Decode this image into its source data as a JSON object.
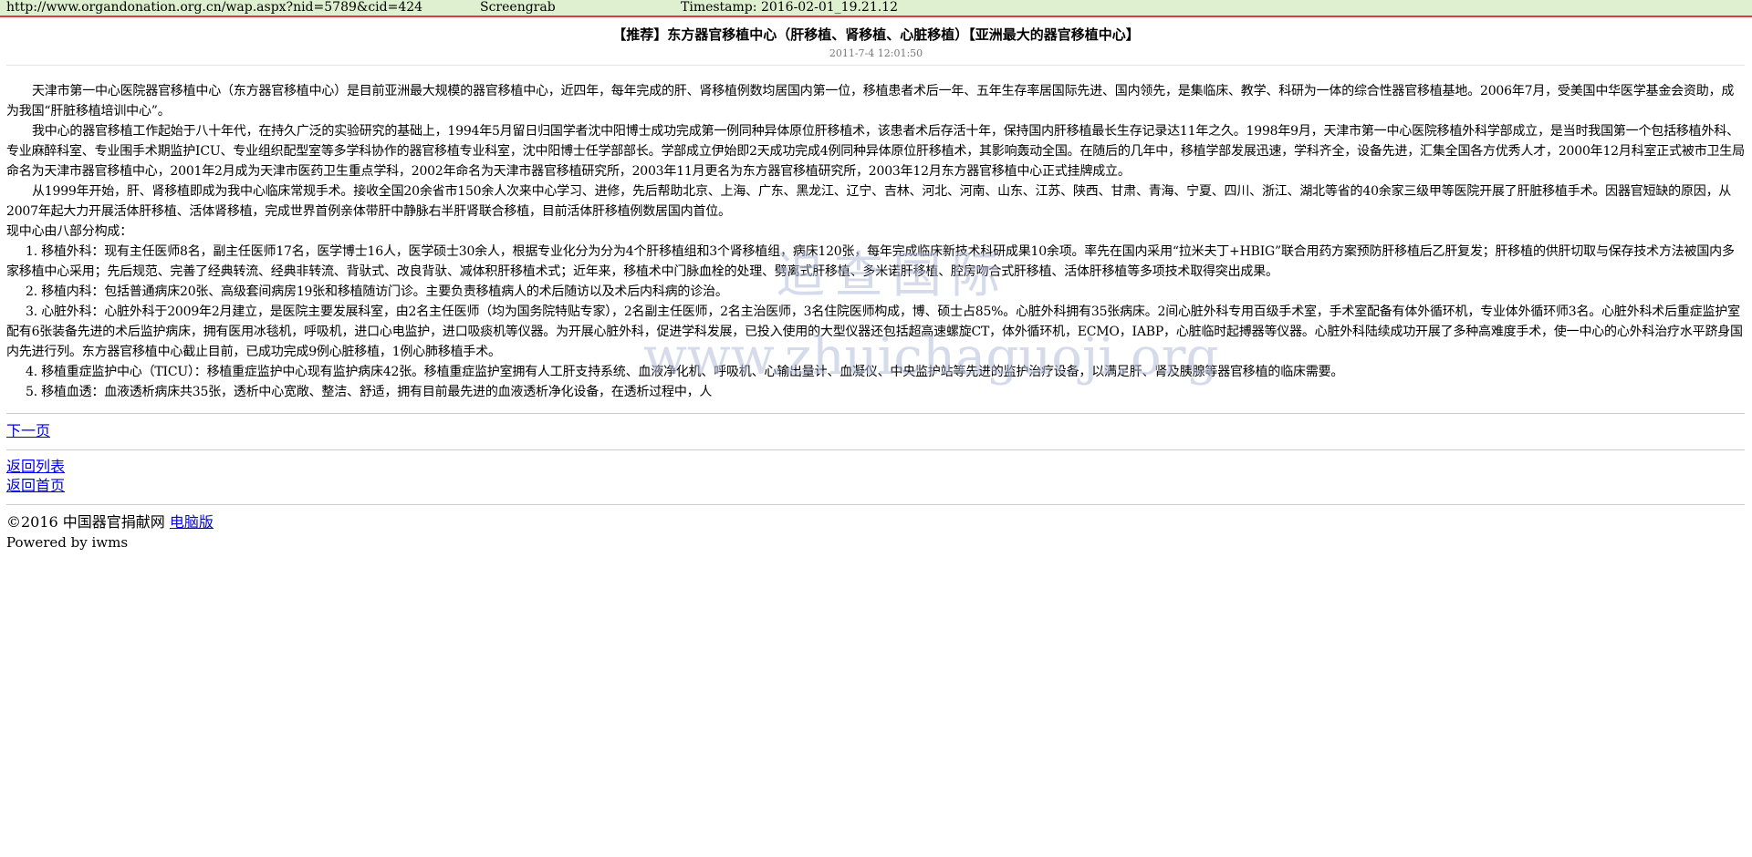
{
  "grab_bar": {
    "url": "http://www.organdonation.org.cn/wap.aspx?nid=5789&cid=424",
    "label": "Screengrab",
    "timestamp": "Timestamp: 2016-02-01_19.21.12"
  },
  "article": {
    "title": "【推荐】东方器官移植中心（肝移植、肾移植、心脏移植）【亚洲最大的器官移植中心】",
    "date": "2011-7-4 12:01:50",
    "paragraphs": [
      "天津市第一中心医院器官移植中心（东方器官移植中心）是目前亚洲最大规模的器官移植中心，近四年，每年完成的肝、肾移植例数均居国内第一位，移植患者术后一年、五年生存率居国际先进、国内领先，是集临床、教学、科研为一体的综合性器官移植基地。2006年7月，受美国中华医学基金会资助，成为我国“肝脏移植培训中心”。",
      "我中心的器官移植工作起始于八十年代，在持久广泛的实验研究的基础上，1994年5月留日归国学者沈中阳博士成功完成第一例同种异体原位肝移植术，该患者术后存活十年，保持国内肝移植最长生存记录达11年之久。1998年9月，天津市第一中心医院移植外科学部成立，是当时我国第一个包括移植外科、专业麻醉科室、专业围手术期监护ICU、专业组织配型室等多学科协作的器官移植专业科室，沈中阳博士任学部部长。学部成立伊始即2天成功完成4例同种异体原位肝移植术，其影响轰动全国。在随后的几年中，移植学部发展迅速，学科齐全，设备先进，汇集全国各方优秀人才，2000年12月科室正式被市卫生局命名为天津市器官移植中心，2001年2月成为天津市医药卫生重点学科，2002年命名为天津市器官移植研究所，2003年11月更名为东方器官移植研究所，2003年12月东方器官移植中心正式挂牌成立。",
      "从1999年开始，肝、肾移植即成为我中心临床常规手术。接收全国20余省市150余人次来中心学习、进修，先后帮助北京、上海、广东、黑龙江、辽宁、吉林、河北、河南、山东、江苏、陕西、甘肃、青海、宁夏、四川、浙江、湖北等省的40余家三级甲等医院开展了肝脏移植手术。因器官短缺的原因，从2007年起大力开展活体肝移植、活体肾移植，完成世界首例亲体带肝中静脉右半肝肾联合移植，目前活体肝移植例数居国内首位。"
    ],
    "section_intro": "现中心由八部分构成：",
    "items": [
      "1. 移植外科：现有主任医师8名，副主任医师17名，医学博士16人，医学硕士30余人，根据专业化分为分为4个肝移植组和3个肾移植组，病床120张，每年完成临床新技术科研成果10余项。率先在国内采用“拉米夫丁+HBIG”联合用药方案预防肝移植后乙肝复发；肝移植的供肝切取与保存技术方法被国内多家移植中心采用；先后规范、完善了经典转流、经典非转流、背驮式、改良背驮、减体积肝移植术式；近年来，移植术中门脉血栓的处理、劈离式肝移植、多米诺肝移植、腔房吻合式肝移植、活体肝移植等多项技术取得突出成果。",
      "2. 移植内科：包括普通病床20张、高级套间病房19张和移植随访门诊。主要负责移植病人的术后随访以及术后内科病的诊治。",
      "3. 心脏外科：心脏外科于2009年2月建立，是医院主要发展科室，由2名主任医师（均为国务院特贴专家），2名副主任医师，2名主治医师，3名住院医师构成，博、硕士占85%。心脏外科拥有35张病床。2间心脏外科专用百级手术室，手术室配备有体外循环机，专业体外循环师3名。心脏外科术后重症监护室配有6张装备先进的术后监护病床，拥有医用冰毯机，呼吸机，进口心电监护，进口吸痰机等仪器。为开展心脏外科，促进学科发展，已投入使用的大型仪器还包括超高速螺旋CT，体外循环机，ECMO，IABP，心脏临时起搏器等仪器。心脏外科陆续成功开展了多种高难度手术，使一中心的心外科治疗水平跻身国内先进行列。东方器官移植中心截止目前，已成功完成9例心脏移植，1例心肺移植手术。",
      "4. 移植重症监护中心（TICU）：移植重症监护中心现有监护病床42张。移植重症监护室拥有人工肝支持系统、血液净化机、呼吸机、心输出量计、血凝仪、中央监护站等先进的监护治疗设备，以满足肝、肾及胰腺等器官移植的临床需要。",
      "5. 移植血透：血液透析病床共35张，透析中心宽敞、整洁、舒适，拥有目前最先进的血液透析净化设备，在透析过程中，人"
    ]
  },
  "watermark": {
    "chinese": "追查国际",
    "url": "www.zhuichaguoji.org"
  },
  "nav": {
    "next_page": "下一页",
    "back_list": "返回列表",
    "back_home": "返回首页"
  },
  "footer": {
    "copyright": "©2016 中国器官捐献网 ",
    "desktop_link": "电脑版",
    "powered_by": "Powered by iwms"
  }
}
